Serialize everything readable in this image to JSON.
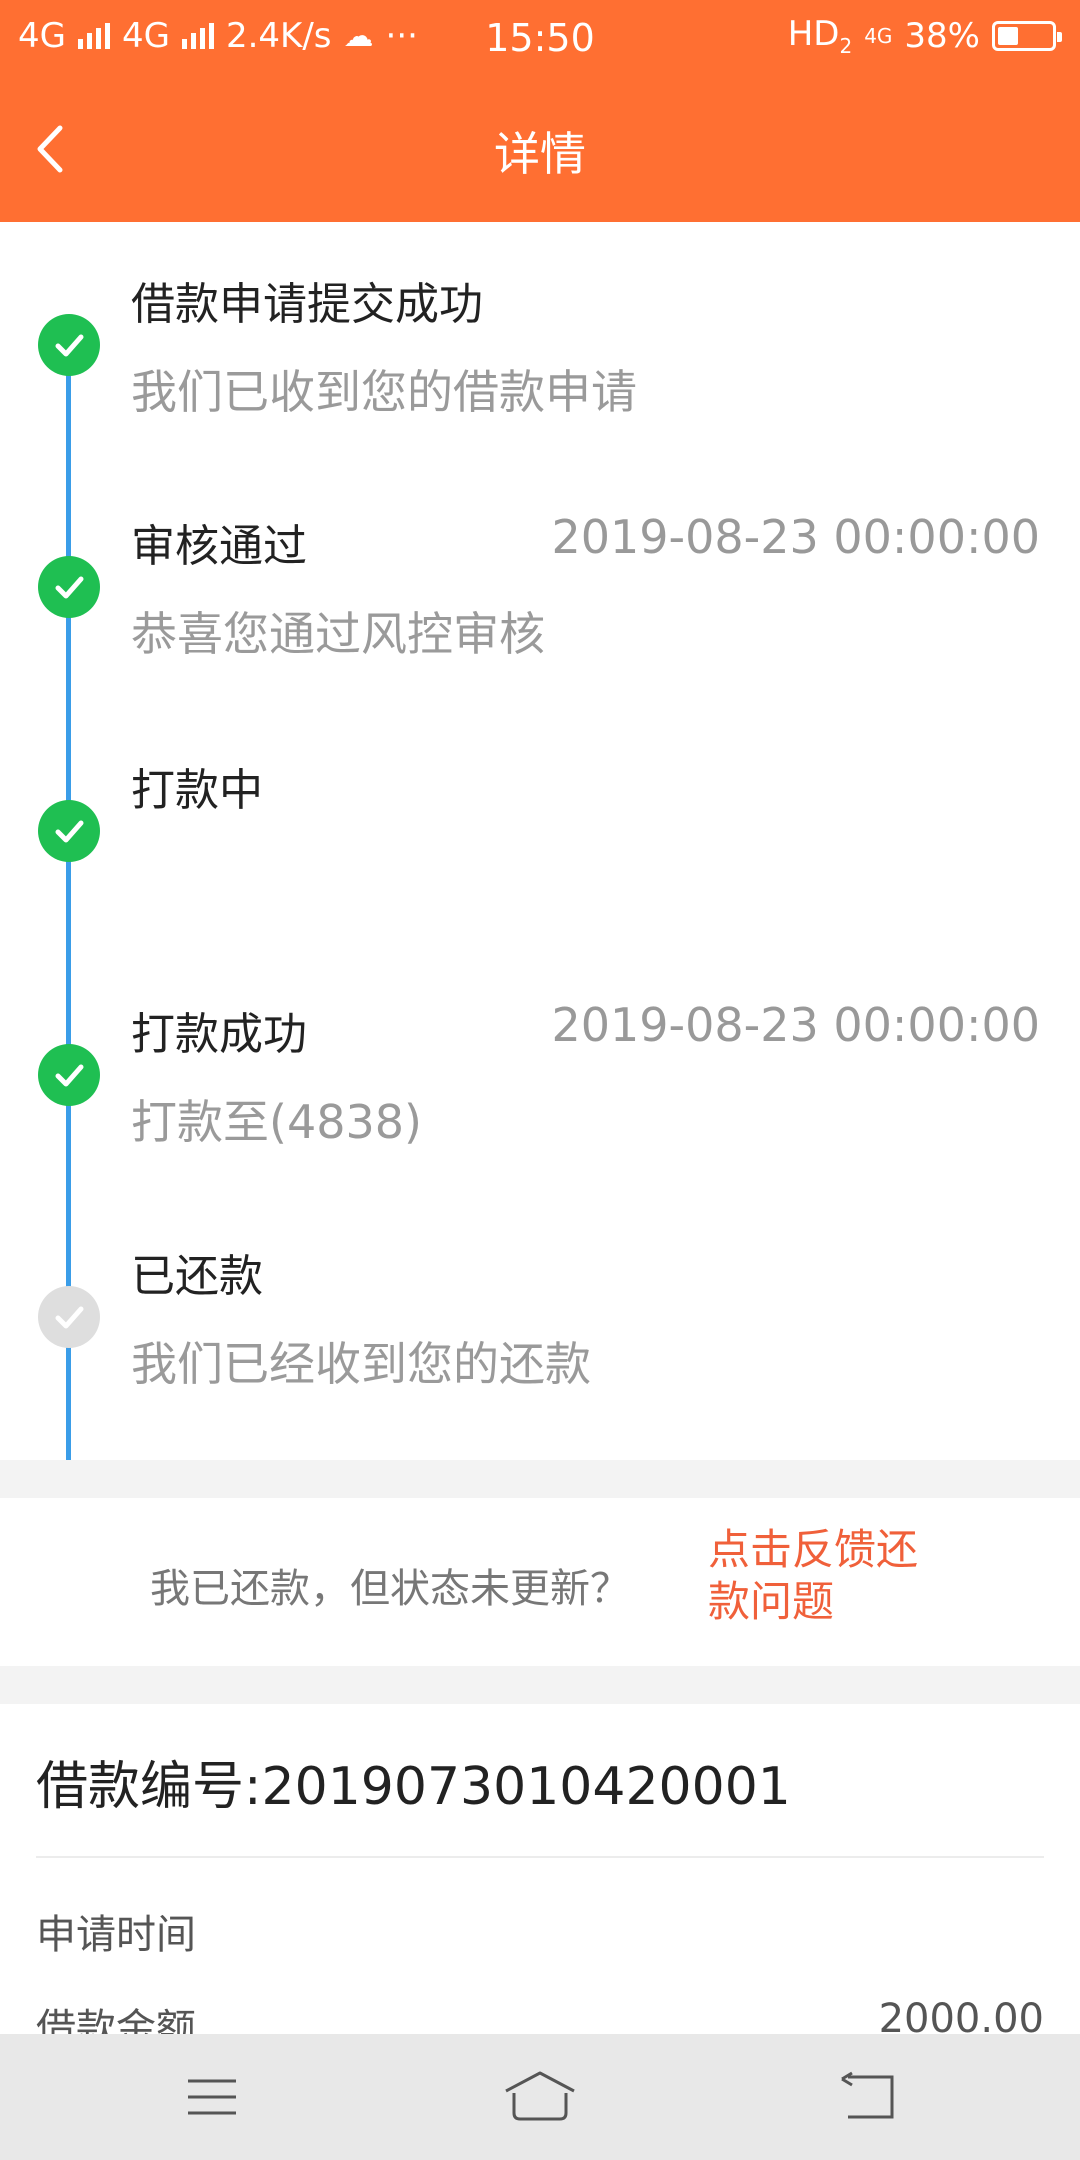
{
  "status_bar": {
    "network1": "4G",
    "network2": "4G",
    "speed": "2.4K/s",
    "more": "···",
    "time": "15:50",
    "hd": "HD",
    "hd_sub": "2",
    "net3": "4G",
    "battery_percent_text": "38%",
    "battery_level": 0.38
  },
  "nav": {
    "title": "详情"
  },
  "timeline": {
    "steps": [
      {
        "title": "借款申请提交成功",
        "time": "",
        "desc": "我们已收到您的借款申请",
        "done": true
      },
      {
        "title": "审核通过",
        "time": "2019-08-23 00:00:00",
        "desc": "恭喜您通过风控审核",
        "done": true
      },
      {
        "title": "打款中",
        "time": "",
        "desc": "",
        "done": true
      },
      {
        "title": "打款成功",
        "time": "2019-08-23 00:00:00",
        "desc": "打款至(4838)",
        "done": true
      },
      {
        "title": "已还款",
        "time": "",
        "desc": "我们已经收到您的还款",
        "done": false
      }
    ]
  },
  "feedback": {
    "question": "我已还款，但状态未更新？",
    "link_line1": "点击反馈还",
    "link_line2": "款问题"
  },
  "detail": {
    "loan_no": "借款编号:2019073010420001",
    "rows": [
      {
        "label": "申请时间",
        "value": ""
      },
      {
        "label": "借款金额",
        "value": "2000.00"
      }
    ]
  },
  "colors": {
    "brand": "#ff6f32",
    "check_done": "#1fbf52",
    "check_pending": "#dedede",
    "timeline_line": "#3a9de8",
    "link": "#f0603a"
  }
}
